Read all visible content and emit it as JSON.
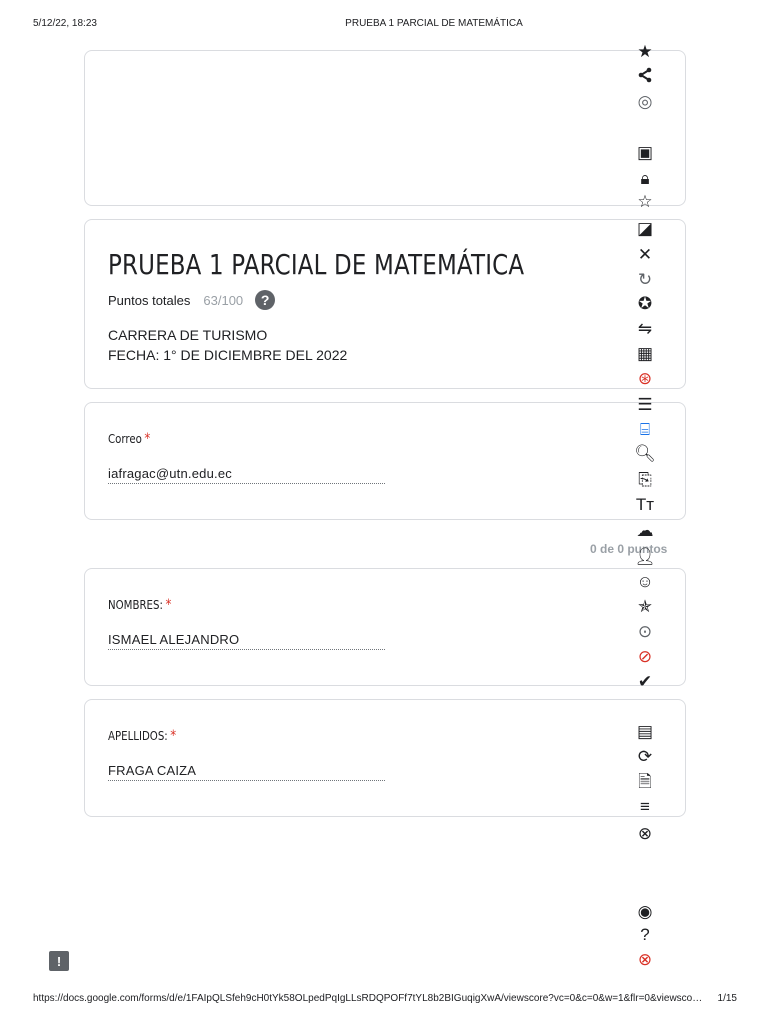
{
  "print": {
    "date": "5/12/22, 18:23",
    "title": "PRUEBA 1 PARCIAL DE MATEMÁTICA",
    "url": "https://docs.google.com/forms/d/e/1FAIpQLSfeh9cH0tYk58OLpedPqIgLLsRDQPOFf7tYL8b2BIGuqigXwA/viewscore?vc=0&c=0&w=1&flr=0&viewsco…",
    "page": "1/15"
  },
  "form": {
    "title": "PRUEBA 1 PARCIAL DE MATEMÁTICA",
    "score_label": "Puntos totales",
    "score_value": "63/100",
    "description_line1": "CARRERA DE TURISMO",
    "description_line2": "FECHA: 1° DE DICIEMBRE DEL 2022"
  },
  "points_note": "0 de 0 puntos",
  "questions": [
    {
      "label": "Correo",
      "required": "*",
      "answer": "iafragac@utn.edu.ec"
    },
    {
      "label": "NOMBRES:",
      "required": "*",
      "answer": "ISMAEL ALEJANDRO"
    },
    {
      "label": "APELLIDOS:",
      "required": "*",
      "answer": "FRAGA CAIZA"
    }
  ],
  "icons": {
    "help": "?",
    "feedback": "!"
  },
  "colors": {
    "required": "#d93025",
    "border": "#dadce0",
    "muted": "#9aa0a6"
  }
}
